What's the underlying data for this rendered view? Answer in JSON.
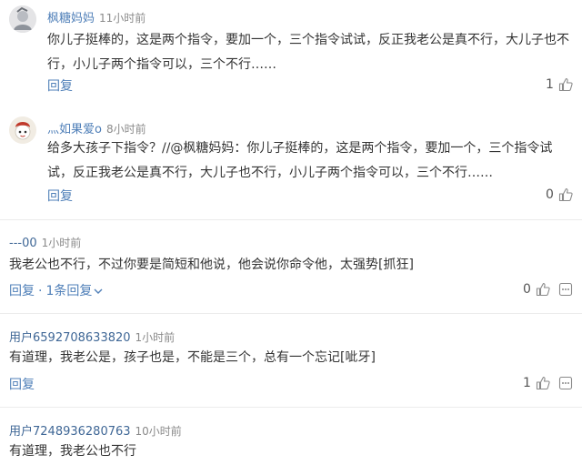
{
  "comments": [
    {
      "user": "枫糖妈妈",
      "time": "11小时前",
      "lines": [
        "你儿子挺棒的，这是两个指令，要加一个，三个指令试试，反正我老公是真不行，大儿子也不",
        "行，小儿子两个指令可以，三个不行……"
      ],
      "reply_label": "回复",
      "likes": "1"
    },
    {
      "user": "灬如果爱o",
      "time": "8小时前",
      "lines": [
        "给多大孩子下指令？//@枫糖妈妈：你儿子挺棒的，这是两个指令，要加一个，三个指令试",
        "试，反正我老公是真不行，大儿子也不行，小儿子两个指令可以，三个不行……"
      ],
      "reply_label": "回复",
      "likes": "0"
    },
    {
      "user": "---00",
      "time": "1小时前",
      "lines": [
        "我老公也不行，不过你要是简短和他说，他会说你命令他，太强势[抓狂]"
      ],
      "reply_label": "回复",
      "replies_label": "1条回复",
      "likes": "0"
    },
    {
      "user": "用户6592708633820",
      "time": "1小时前",
      "lines": [
        "有道理，我老公是，孩子也是，不能是三个，总有一个忘记[呲牙]"
      ],
      "reply_label": "回复",
      "likes": "1"
    },
    {
      "user": "用户7248936280763",
      "time": "10小时前",
      "lines": [
        "有道理，我老公也不行"
      ]
    }
  ],
  "icons": {
    "like": "thumbs-up-icon",
    "more": "more-icon",
    "expand": "chevron-down-icon"
  },
  "colors": {
    "link": "#4f7fb8",
    "text": "#333333",
    "meta": "#8a8a8a",
    "separator": "#ececec"
  }
}
